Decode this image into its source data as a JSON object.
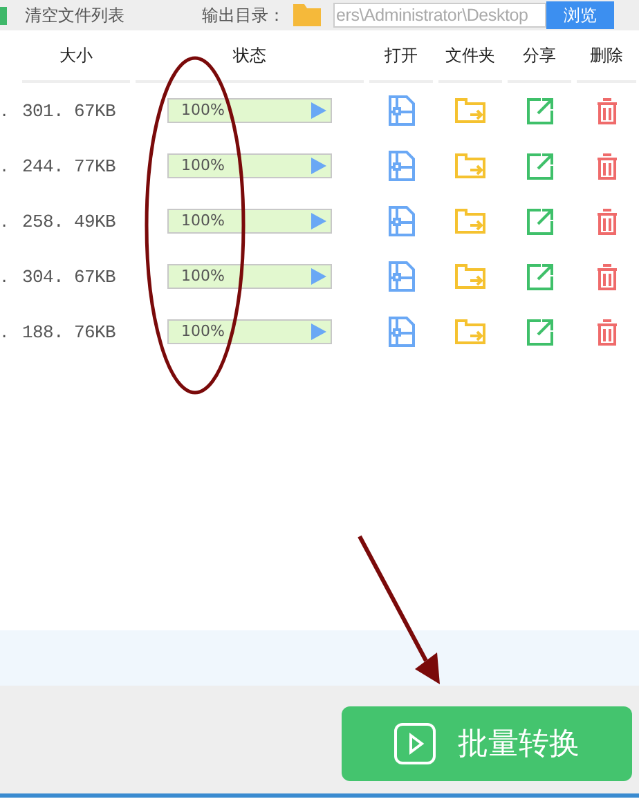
{
  "toolbar": {
    "clear_label": "清空文件列表",
    "output_label": "输出目录：",
    "output_path": "ers\\Administrator\\Desktop",
    "browse_button": "浏览"
  },
  "columns": [
    {
      "label": "大小",
      "kind": "size"
    },
    {
      "label": "状态",
      "kind": "status"
    },
    {
      "label": "打开",
      "kind": "open"
    },
    {
      "label": "文件夹",
      "kind": "folder"
    },
    {
      "label": "分享",
      "kind": "share"
    },
    {
      "label": "删除",
      "kind": "delete"
    }
  ],
  "rows": [
    {
      "name": ".",
      "size": "301. 67KB",
      "level": 1,
      "reading": "100%"
    },
    {
      "name": ".",
      "size": "244. 77KB",
      "level": 1,
      "reading": "100%"
    },
    {
      "name": ".",
      "size": "258. 49KB",
      "level": 1,
      "reading": "100%"
    },
    {
      "name": ".",
      "size": "304. 67KB",
      "level": 1,
      "reading": "100%"
    },
    {
      "name": ".",
      "size": "188. 76KB",
      "level": 1,
      "reading": "100%"
    }
  ],
  "convert_button": "批量转换"
}
